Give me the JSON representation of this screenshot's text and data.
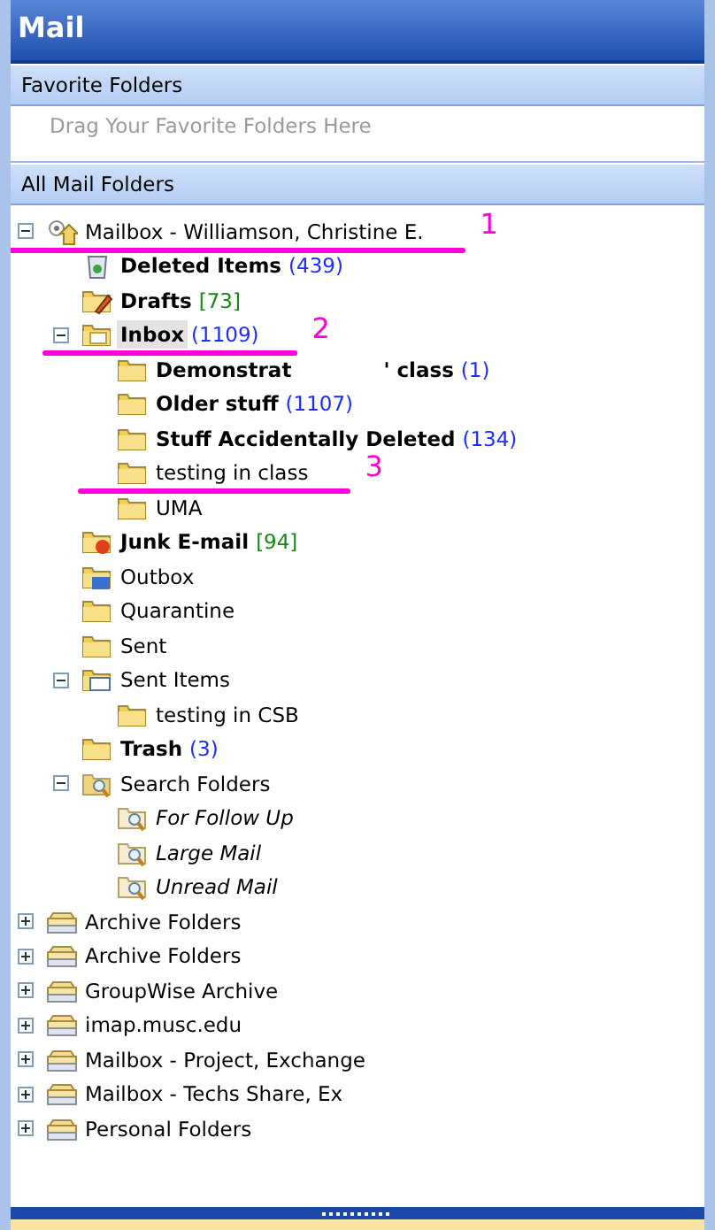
{
  "pane": {
    "title": "Mail"
  },
  "favorites": {
    "heading": "Favorite Folders",
    "placeholder": "Drag Your Favorite Folders Here"
  },
  "all_folders": {
    "heading": "All Mail Folders"
  },
  "tree": [
    {
      "name": "Mailbox - Williamson, Christine E.",
      "kind": "mailbox",
      "expanded": true,
      "bold": false,
      "selected": false,
      "annotation": "1",
      "children": [
        {
          "name": "Deleted Items",
          "kind": "deleted",
          "bold": true,
          "selected": false,
          "count": {
            "text": "(439)",
            "color": "#1a2cff"
          }
        },
        {
          "name": "Drafts",
          "kind": "drafts",
          "bold": true,
          "selected": false,
          "count": {
            "text": "[73]",
            "color": "#148a14"
          }
        },
        {
          "name": "Inbox",
          "kind": "inbox",
          "expanded": true,
          "bold": true,
          "selected": true,
          "count": {
            "text": "(1109)",
            "color": "#1a2cff"
          },
          "annotation": "2",
          "children": [
            {
              "name": "Demonstrat",
              "name_end": "' class",
              "kind": "folder",
              "bold": true,
              "selected": false,
              "count": {
                "text": "(1)",
                "color": "#1a2cff"
              }
            },
            {
              "name": "Older stuff",
              "kind": "folder",
              "bold": true,
              "selected": false,
              "count": {
                "text": "(1107)",
                "color": "#1a2cff"
              }
            },
            {
              "name": "Stuff Accidentally Deleted",
              "kind": "folder",
              "bold": true,
              "selected": false,
              "count": {
                "text": "(134)",
                "color": "#1a2cff"
              }
            },
            {
              "name": "testing in class",
              "kind": "folder",
              "bold": false,
              "selected": false,
              "annotation": "3"
            },
            {
              "name": "UMA",
              "kind": "folder",
              "bold": false,
              "selected": false
            }
          ]
        },
        {
          "name": "Junk E-mail",
          "kind": "junk",
          "bold": true,
          "selected": false,
          "count": {
            "text": "[94]",
            "color": "#148a14"
          }
        },
        {
          "name": "Outbox",
          "kind": "outbox",
          "bold": false,
          "selected": false
        },
        {
          "name": "Quarantine",
          "kind": "folder",
          "bold": false,
          "selected": false
        },
        {
          "name": "Sent",
          "kind": "folder",
          "bold": false,
          "selected": false
        },
        {
          "name": "Sent Items",
          "kind": "sent",
          "expanded": true,
          "bold": false,
          "selected": false,
          "children": [
            {
              "name": "testing in CSB",
              "kind": "folder",
              "bold": false,
              "selected": false
            }
          ]
        },
        {
          "name": "Trash",
          "kind": "folder",
          "bold": true,
          "selected": false,
          "count": {
            "text": "(3)",
            "color": "#1a2cff"
          }
        },
        {
          "name": "Search Folders",
          "kind": "search",
          "expanded": true,
          "bold": false,
          "selected": false,
          "children": [
            {
              "name": "For Follow Up",
              "kind": "search-folder",
              "bold": false,
              "italic": true,
              "selected": false
            },
            {
              "name": "Large Mail",
              "kind": "search-folder",
              "bold": false,
              "italic": true,
              "selected": false
            },
            {
              "name": "Unread Mail",
              "kind": "search-folder",
              "bold": false,
              "italic": true,
              "selected": false
            }
          ]
        }
      ]
    },
    {
      "name": "Archive Folders",
      "kind": "store",
      "expanded": false,
      "bold": false,
      "selected": false
    },
    {
      "name": "Archive Folders",
      "kind": "store",
      "expanded": false,
      "bold": false,
      "selected": false
    },
    {
      "name": "GroupWise Archive",
      "kind": "store",
      "expanded": false,
      "bold": false,
      "selected": false
    },
    {
      "name": "imap.musc.edu",
      "kind": "store",
      "expanded": false,
      "bold": false,
      "selected": false
    },
    {
      "name": "Mailbox - Project, Exchange",
      "kind": "store",
      "expanded": false,
      "bold": false,
      "selected": false
    },
    {
      "name": "Mailbox - Techs Share, Ex",
      "kind": "store",
      "expanded": false,
      "bold": false,
      "selected": false
    },
    {
      "name": "Personal Folders",
      "kind": "store",
      "expanded": false,
      "bold": false,
      "selected": false
    }
  ]
}
